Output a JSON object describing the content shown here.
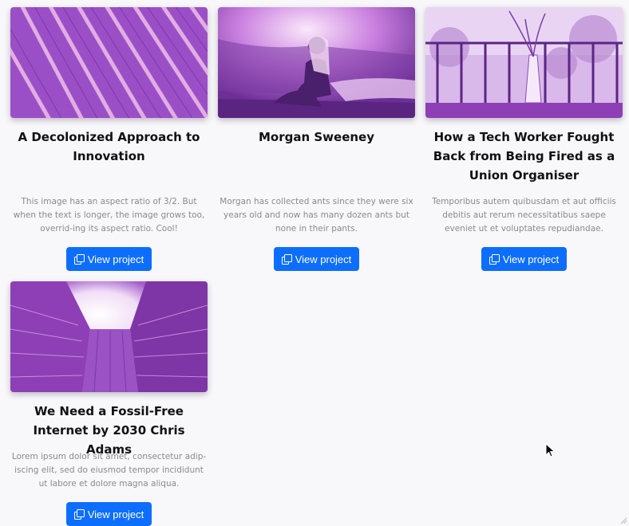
{
  "cards": [
    {
      "title": "A Decolonized Approach to Innovation",
      "description": "This image has an aspect ratio of 3/2. But when the text is longer, the image grows too, overrid-ing its aspect ratio. Cool!",
      "button_label": "View project",
      "button_icon": "copy-icon"
    },
    {
      "title": "Morgan Sweeney",
      "description": "Morgan has collected ants since they were six years old and now has many dozen ants but none in their pants.",
      "button_label": "View project",
      "button_icon": "copy-icon"
    },
    {
      "title": "How a Tech Worker Fought Back from Being Fired as a Union Organiser",
      "description": "Temporibus autem quibusdam et aut officiis debitis aut rerum necessitatibus saepe eveniet ut et voluptates repudiandae.",
      "button_label": "View project",
      "button_icon": "copy-icon"
    },
    {
      "title": "We Need a Fossil-Free Internet by 2030 Chris Adams",
      "description": "Lorem ipsum dolor sit amet, consectetur adip-iscing elit, sed do eiusmod tempor incididunt ut labore et dolore magna aliqua.",
      "button_label": "View project",
      "button_icon": "copy-icon"
    }
  ],
  "colors": {
    "page_background": "#f8f8fa",
    "title_text": "#111111",
    "description_text": "#8a8a8e",
    "button_background": "#0d6efd",
    "button_text": "#ffffff",
    "image_tint": "#8e3fb5"
  }
}
